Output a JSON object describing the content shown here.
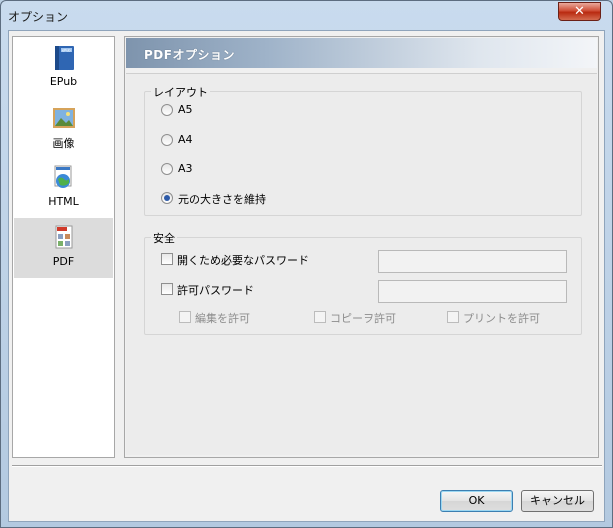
{
  "window": {
    "title": "オプション",
    "close_symbol": "✕"
  },
  "sidebar": {
    "items": [
      {
        "label": "EPub",
        "icon": "epub-book-icon",
        "active": false
      },
      {
        "label": "画像",
        "icon": "image-icon",
        "active": false
      },
      {
        "label": "HTML",
        "icon": "html-globe-icon",
        "active": false
      },
      {
        "label": "PDF",
        "icon": "pdf-document-icon",
        "active": true
      }
    ]
  },
  "panel": {
    "header": "PDFオプション",
    "layout_group": {
      "label": "レイアウト",
      "options": [
        {
          "label": "A5",
          "checked": false
        },
        {
          "label": "A4",
          "checked": false
        },
        {
          "label": "A3",
          "checked": false
        },
        {
          "label": "元の大きさを維持",
          "checked": true
        }
      ]
    },
    "security_group": {
      "label": "安全",
      "open_password_label": "開くため必要なパスワード",
      "open_password_value": "",
      "permission_password_label": "許可パスワード",
      "permission_password_value": "",
      "permissions": [
        {
          "label": "編集を許可"
        },
        {
          "label": "コピーヲ許可"
        },
        {
          "label": "プリントを許可"
        }
      ]
    }
  },
  "buttons": {
    "ok": "OK",
    "cancel": "キャンセル"
  },
  "colors": {
    "accent": "#2d5aa8",
    "close": "#c8432a",
    "header_start": "#7e94ad"
  }
}
